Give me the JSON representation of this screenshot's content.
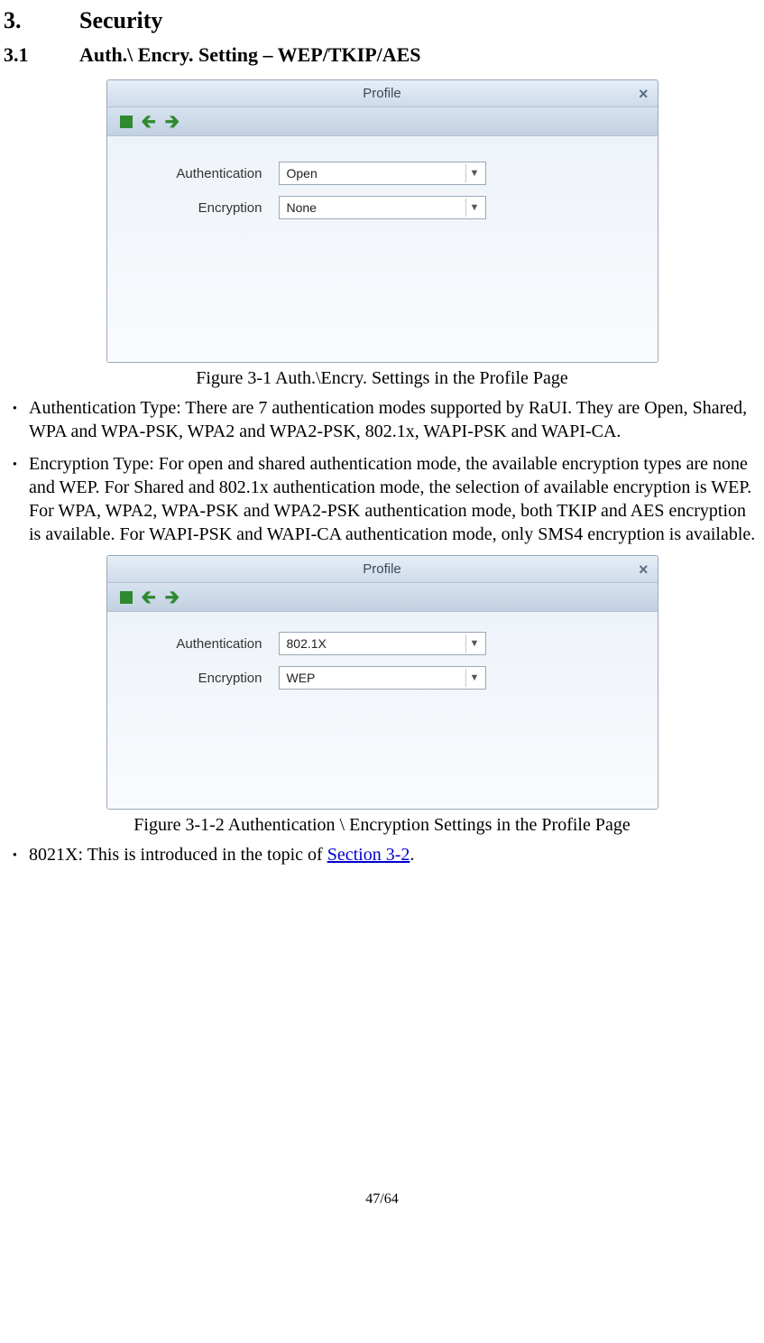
{
  "headings": {
    "h2_num": "3.",
    "h2_txt": "Security",
    "h3_num": "3.1",
    "h3_txt": "Auth.\\ Encry. Setting – WEP/TKIP/AES"
  },
  "dialog1": {
    "title": "Profile",
    "auth_label": "Authentication",
    "enc_label": "Encryption",
    "auth_value": "Open",
    "enc_value": "None"
  },
  "caption1": "Figure 3-1 Auth.\\Encry. Settings in the Profile Page",
  "bullet1": "Authentication Type: There are 7 authentication modes supported by RaUI. They are Open, Shared, WPA and WPA-PSK, WPA2 and WPA2-PSK, 802.1x, WAPI-PSK and WAPI-CA.",
  "bullet2": "Encryption Type: For open and shared authentication mode, the available encryption types are none and WEP. For Shared and 802.1x authentication mode, the selection of available encryption is WEP. For WPA, WPA2, WPA-PSK and WPA2-PSK authentication mode, both TKIP and AES encryption is available. For WAPI-PSK and WAPI-CA authentication mode, only SMS4 encryption is available.",
  "dialog2": {
    "title": "Profile",
    "auth_label": "Authentication",
    "enc_label": "Encryption",
    "auth_value": "802.1X",
    "enc_value": "WEP"
  },
  "caption2": "Figure 3-1-2 Authentication \\ Encryption Settings in the Profile Page",
  "bullet3_prefix": "8021X: This is introduced in the topic of ",
  "bullet3_link": "Section 3-2",
  "bullet3_suffix": ".",
  "page_footer": "47/64"
}
